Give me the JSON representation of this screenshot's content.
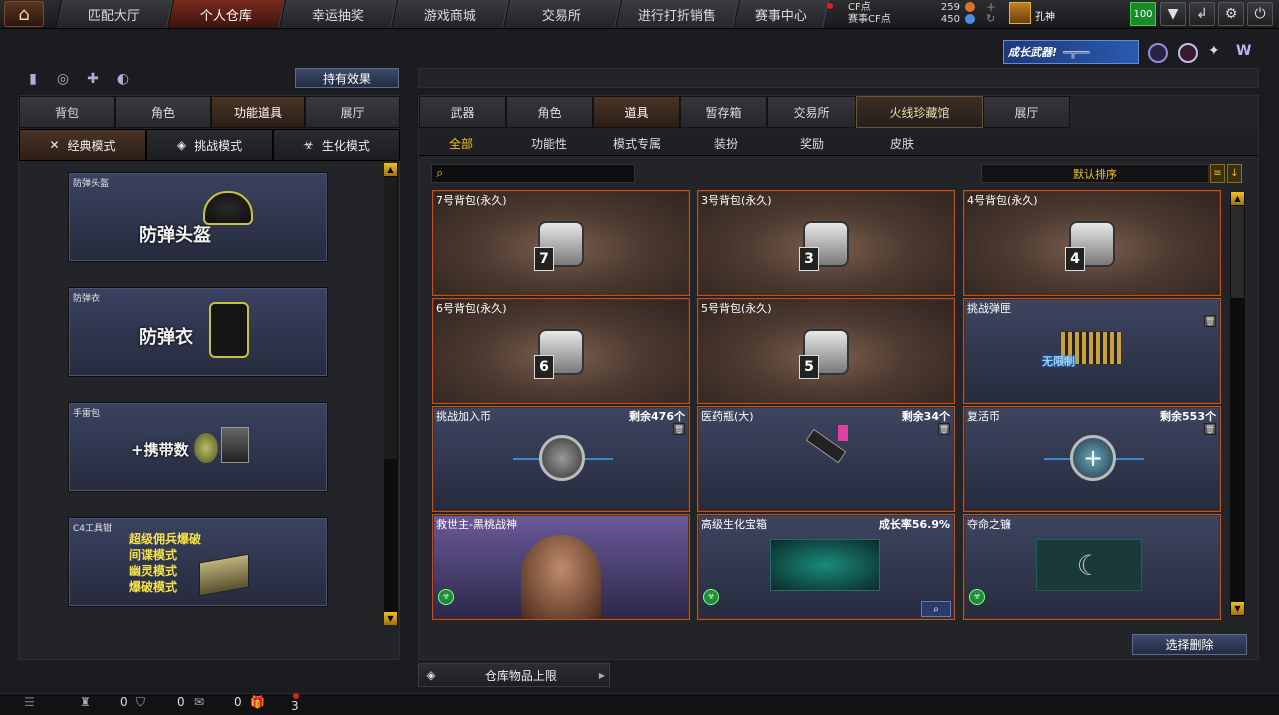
{
  "nav": {
    "tabs": [
      "匹配大厅",
      "个人仓库",
      "幸运抽奖",
      "游戏商城",
      "交易所",
      "进行打折销售",
      "赛事中心"
    ],
    "active_index": 1
  },
  "currency": {
    "cf_label": "CF点",
    "cf_value": "259",
    "event_cf_label": "赛事CF点",
    "event_cf_value": "450"
  },
  "user": {
    "name": "孔神",
    "level": "100"
  },
  "banner": {
    "text": "成长武器!"
  },
  "left": {
    "effect_button": "持有效果",
    "tabs": [
      "背包",
      "角色",
      "功能道具",
      "展厅"
    ],
    "active_tab": 2,
    "mode_tabs": [
      "经典模式",
      "挑战模式",
      "生化模式"
    ],
    "active_mode": 0,
    "cards": [
      {
        "label": "防弹头盔",
        "big": "防弹头盔"
      },
      {
        "label": "防弹衣",
        "big": "防弹衣"
      },
      {
        "label": "手雷包",
        "big": "+携带数"
      },
      {
        "label": "C4工具钳",
        "lines": [
          "超级佣兵爆破",
          "间谍模式",
          "幽灵模式",
          "爆破模式"
        ]
      }
    ]
  },
  "right": {
    "tabs": [
      "武器",
      "角色",
      "道具",
      "暂存箱",
      "交易所",
      "火线珍藏馆",
      "展厅"
    ],
    "active_tab": 2,
    "subtabs": [
      "全部",
      "功能性",
      "模式专属",
      "装扮",
      "奖励",
      "皮肤"
    ],
    "active_subtab": 0,
    "search_placeholder": "",
    "sort_label": "默认排序",
    "items": [
      {
        "name": "7号背包(永久)",
        "type": "bag",
        "num": "7"
      },
      {
        "name": "3号背包(永久)",
        "type": "bag",
        "num": "3"
      },
      {
        "name": "4号背包(永久)",
        "type": "bag",
        "num": "4"
      },
      {
        "name": "6号背包(永久)",
        "type": "bag",
        "num": "6"
      },
      {
        "name": "5号背包(永久)",
        "type": "bag",
        "num": "5"
      },
      {
        "name": "挑战弹匣",
        "type": "blue",
        "icon_text": "无限制"
      },
      {
        "name": "挑战加入币",
        "type": "blue",
        "remain": "剩余476个"
      },
      {
        "name": "医药瓶(大)",
        "type": "blue",
        "remain": "剩余34个"
      },
      {
        "name": "复活币",
        "type": "blue",
        "remain": "剩余553个"
      },
      {
        "name": "救世主-黑桃战神",
        "type": "purple"
      },
      {
        "name": "高级生化宝箱",
        "type": "blue",
        "remain": "成长率56.9%"
      },
      {
        "name": "夺命之镰",
        "type": "blue"
      }
    ],
    "delete_button": "选择删除",
    "capacity_label": "仓库物品上限"
  },
  "bottom": {
    "count1": "0",
    "count2": "0",
    "count3": "0",
    "count4": "3"
  }
}
